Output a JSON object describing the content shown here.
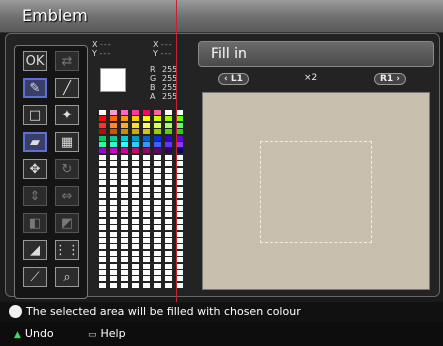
{
  "window": {
    "title": "Emblem"
  },
  "tools": [
    {
      "name": "ok-tool",
      "glyph": "OK",
      "selected": false,
      "dim": false
    },
    {
      "name": "swap-tool",
      "glyph": "⇄",
      "selected": false,
      "dim": true
    },
    {
      "name": "eraser-tool",
      "glyph": "✎",
      "selected": true,
      "dim": false
    },
    {
      "name": "line-tool",
      "glyph": "╱",
      "selected": false,
      "dim": false
    },
    {
      "name": "rectangle-tool",
      "glyph": "□",
      "selected": false,
      "dim": false
    },
    {
      "name": "pin-tool",
      "glyph": "✦",
      "selected": false,
      "dim": false
    },
    {
      "name": "fill-tool",
      "glyph": "▰",
      "selected": true,
      "dim": false
    },
    {
      "name": "palette-tool",
      "glyph": "▦",
      "selected": false,
      "dim": false
    },
    {
      "name": "move-tool",
      "glyph": "✥",
      "selected": false,
      "dim": false
    },
    {
      "name": "rotate-tool",
      "glyph": "↻",
      "selected": false,
      "dim": true
    },
    {
      "name": "flip-vertical-tool",
      "glyph": "⇕",
      "selected": false,
      "dim": true
    },
    {
      "name": "flip-horizontal-tool",
      "glyph": "⇔",
      "selected": false,
      "dim": true
    },
    {
      "name": "copy-tool",
      "glyph": "◧",
      "selected": false,
      "dim": true
    },
    {
      "name": "paste-tool",
      "glyph": "◩",
      "selected": false,
      "dim": true
    },
    {
      "name": "gradient-tool",
      "glyph": "◢",
      "selected": false,
      "dim": false
    },
    {
      "name": "grid-tool",
      "glyph": "⋮⋮",
      "selected": false,
      "dim": false
    },
    {
      "name": "pick-tool",
      "glyph": "⟋",
      "selected": false,
      "dim": false
    },
    {
      "name": "zoom-tool",
      "glyph": "⌕",
      "selected": false,
      "dim": false
    }
  ],
  "coords": {
    "x_label": "X",
    "y_label": "Y",
    "left": {
      "x": "---",
      "y": "---"
    },
    "right": {
      "x": "---",
      "y": "---"
    }
  },
  "color": {
    "current": "#ffffff",
    "r_label": "R",
    "r": "255",
    "g_label": "G",
    "g": "255",
    "b_label": "B",
    "b": "255",
    "a_label": "A",
    "a": "255"
  },
  "palette_colors": [
    [
      "#ffffff",
      "#ff99cc",
      "#ff66cc",
      "#ff33aa",
      "#ff0066",
      "#ff6699",
      "#ffffff",
      "#ffffff"
    ],
    [
      "#ff0000",
      "#ff6600",
      "#ff9900",
      "#ffcc00",
      "#ffff00",
      "#ccff00",
      "#99ff00",
      "#66ff00"
    ],
    [
      "#ff3333",
      "#ff8833",
      "#ffaa33",
      "#ffdd33",
      "#ffff66",
      "#ddff66",
      "#aaff66",
      "#66ff66"
    ],
    [
      "#cc0000",
      "#cc5500",
      "#cc8800",
      "#ccaa00",
      "#cccc00",
      "#99cc00",
      "#66cc00",
      "#33cc00"
    ],
    [
      "#00cc66",
      "#00cc99",
      "#00cccc",
      "#0099cc",
      "#0066cc",
      "#0033cc",
      "#3300cc",
      "#6600cc"
    ],
    [
      "#33ff99",
      "#33ffcc",
      "#33ffff",
      "#33ccff",
      "#3399ff",
      "#3366ff",
      "#6633ff",
      "#9933ff"
    ],
    [
      "#9900cc",
      "#cc00cc",
      "#cc0099",
      "#cc0066",
      "#990066",
      "#660066",
      "#330066",
      "#000066"
    ],
    [
      "#ffffff",
      "#ffffff",
      "#ffffff",
      "#ffffff",
      "#ffffff",
      "#ffffff",
      "#ffffff",
      "#ffffff"
    ],
    [
      "#ffffff",
      "#ffffff",
      "#ffffff",
      "#ffffff",
      "#ffffff",
      "#ffffff",
      "#ffffff",
      "#ffffff"
    ],
    [
      "#ffffff",
      "#ffffff",
      "#ffffff",
      "#ffffff",
      "#ffffff",
      "#ffffff",
      "#ffffff",
      "#ffffff"
    ],
    [
      "#ffffff",
      "#ffffff",
      "#ffffff",
      "#ffffff",
      "#ffffff",
      "#ffffff",
      "#ffffff",
      "#ffffff"
    ],
    [
      "#ffffff",
      "#ffffff",
      "#ffffff",
      "#ffffff",
      "#ffffff",
      "#ffffff",
      "#ffffff",
      "#ffffff"
    ],
    [
      "#ffffff",
      "#ffffff",
      "#ffffff",
      "#ffffff",
      "#ffffff",
      "#ffffff",
      "#ffffff",
      "#ffffff"
    ],
    [
      "#ffffff",
      "#ffffff",
      "#ffffff",
      "#ffffff",
      "#ffffff",
      "#ffffff",
      "#ffffff",
      "#ffffff"
    ],
    [
      "#ffffff",
      "#ffffff",
      "#ffffff",
      "#ffffff",
      "#ffffff",
      "#ffffff",
      "#ffffff",
      "#ffffff"
    ],
    [
      "#ffffff",
      "#ffffff",
      "#ffffff",
      "#ffffff",
      "#ffffff",
      "#ffffff",
      "#ffffff",
      "#ffffff"
    ],
    [
      "#ffffff",
      "#ffffff",
      "#ffffff",
      "#ffffff",
      "#ffffff",
      "#ffffff",
      "#ffffff",
      "#ffffff"
    ],
    [
      "#ffffff",
      "#ffffff",
      "#ffffff",
      "#ffffff",
      "#ffffff",
      "#ffffff",
      "#ffffff",
      "#ffffff"
    ],
    [
      "#ffffff",
      "#ffffff",
      "#ffffff",
      "#ffffff",
      "#ffffff",
      "#ffffff",
      "#ffffff",
      "#ffffff"
    ],
    [
      "#ffffff",
      "#ffffff",
      "#ffffff",
      "#ffffff",
      "#ffffff",
      "#ffffff",
      "#ffffff",
      "#ffffff"
    ],
    [
      "#ffffff",
      "#ffffff",
      "#ffffff",
      "#ffffff",
      "#ffffff",
      "#ffffff",
      "#ffffff",
      "#ffffff"
    ],
    [
      "#ffffff",
      "#ffffff",
      "#ffffff",
      "#ffffff",
      "#ffffff",
      "#ffffff",
      "#ffffff",
      "#ffffff"
    ],
    [
      "#ffffff",
      "#ffffff",
      "#ffffff",
      "#ffffff",
      "#ffffff",
      "#ffffff",
      "#ffffff",
      "#ffffff"
    ],
    [
      "#ffffff",
      "#ffffff",
      "#ffffff",
      "#ffffff",
      "#ffffff",
      "#ffffff",
      "#ffffff",
      "#ffffff"
    ],
    [
      "#ffffff",
      "#ffffff",
      "#ffffff",
      "#ffffff",
      "#ffffff",
      "#ffffff",
      "#ffffff",
      "#ffffff"
    ],
    [
      "#ffffff",
      "#ffffff",
      "#ffffff",
      "#ffffff",
      "#ffffff",
      "#ffffff",
      "#ffffff",
      "#ffffff"
    ],
    [
      "#ffffff",
      "#ffffff",
      "#ffffff",
      "#ffffff",
      "#ffffff",
      "#ffffff",
      "#ffffff",
      "#ffffff"
    ],
    [
      "#ffffff",
      "#ffffff",
      "#ffffff",
      "#ffffff",
      "#ffffff",
      "#ffffff",
      "#ffffff",
      "#ffffff"
    ]
  ],
  "panel": {
    "title": "Fill in",
    "nav_left": "L1",
    "nav_left_arrow": "‹",
    "zoom": "×2",
    "nav_right": "R1",
    "nav_right_arrow": "›"
  },
  "status": {
    "message": "The selected area will be filled with chosen colour",
    "message_icon": "info-icon"
  },
  "footer": {
    "undo_label": "Undo",
    "undo_icon": "triangle-button-icon",
    "help_label": "Help",
    "help_icon": "select-button-icon"
  }
}
